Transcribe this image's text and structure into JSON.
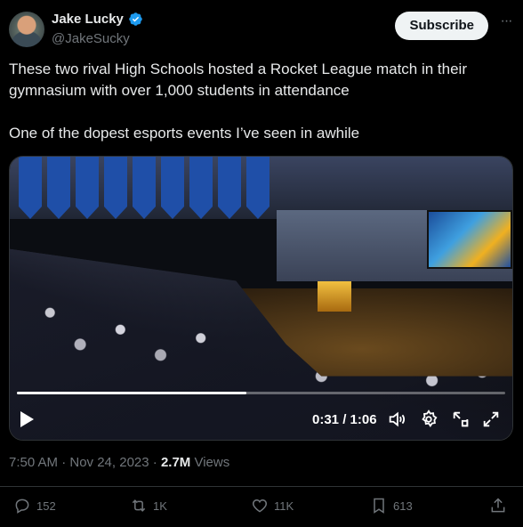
{
  "author": {
    "display_name": "Jake Lucky",
    "handle": "@JakeSucky",
    "verified": true
  },
  "subscribe_label": "Subscribe",
  "more_label": "···",
  "tweet": {
    "line1": "These two rival High Schools hosted a Rocket League match in their gymnasium with over 1,000 students in attendance",
    "line2": "One of the dopest esports events I’ve seen in awhile"
  },
  "video": {
    "time_label": "0:31 / 1:06",
    "progress": 0.47
  },
  "meta": {
    "timestamp": "7:50 AM · Nov 24, 2023 · ",
    "views_count": "2.7M",
    "views_label": " Views"
  },
  "actions": {
    "replies": "152",
    "reposts": "1K",
    "likes": "11K",
    "bookmarks": "613"
  },
  "colors": {
    "background": "#000000",
    "text_primary": "#e7e9ea",
    "text_secondary": "#71767b",
    "verified_blue": "#1d9bf0",
    "subscribe_bg": "#eff3f4",
    "divider": "#2f3336"
  }
}
